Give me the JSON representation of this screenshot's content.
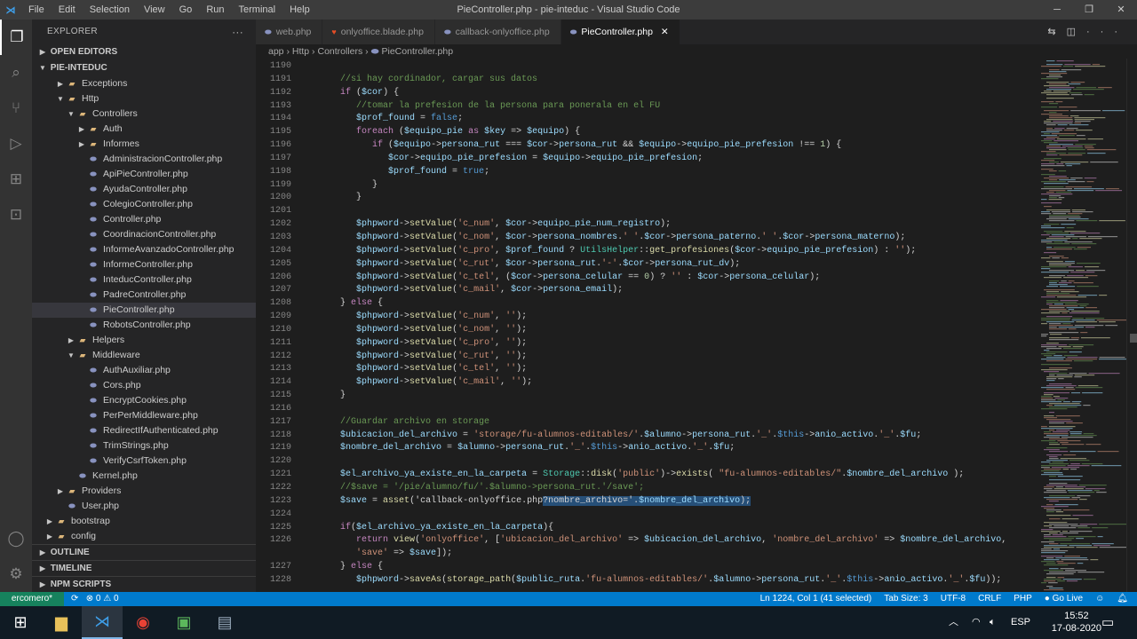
{
  "titlebar": {
    "title": "PieController.php - pie-inteduc - Visual Studio Code",
    "menu": [
      "File",
      "Edit",
      "Selection",
      "View",
      "Go",
      "Run",
      "Terminal",
      "Help"
    ]
  },
  "sidebar": {
    "title": "EXPLORER",
    "open_editors": "OPEN EDITORS",
    "root": "PIE-INTEDUC",
    "tree": [
      {
        "label": "Exceptions",
        "type": "folder",
        "depth": 1,
        "open": false
      },
      {
        "label": "Http",
        "type": "folder",
        "depth": 1,
        "open": true
      },
      {
        "label": "Controllers",
        "type": "folder",
        "depth": 2,
        "open": true
      },
      {
        "label": "Auth",
        "type": "folder",
        "depth": 3,
        "open": false
      },
      {
        "label": "Informes",
        "type": "folder",
        "depth": 3,
        "open": false
      },
      {
        "label": "AdministracionController.php",
        "type": "php",
        "depth": 3
      },
      {
        "label": "ApiPieController.php",
        "type": "php",
        "depth": 3
      },
      {
        "label": "AyudaController.php",
        "type": "php",
        "depth": 3
      },
      {
        "label": "ColegioController.php",
        "type": "php",
        "depth": 3
      },
      {
        "label": "Controller.php",
        "type": "php",
        "depth": 3
      },
      {
        "label": "CoordinacionController.php",
        "type": "php",
        "depth": 3
      },
      {
        "label": "InformeAvanzadoController.php",
        "type": "php",
        "depth": 3
      },
      {
        "label": "InformeController.php",
        "type": "php",
        "depth": 3
      },
      {
        "label": "InteducController.php",
        "type": "php",
        "depth": 3
      },
      {
        "label": "PadreController.php",
        "type": "php",
        "depth": 3
      },
      {
        "label": "PieController.php",
        "type": "php",
        "depth": 3,
        "selected": true
      },
      {
        "label": "RobotsController.php",
        "type": "php",
        "depth": 3
      },
      {
        "label": "Helpers",
        "type": "folder",
        "depth": 2,
        "open": false
      },
      {
        "label": "Middleware",
        "type": "folder",
        "depth": 2,
        "open": true
      },
      {
        "label": "AuthAuxiliar.php",
        "type": "php",
        "depth": 3
      },
      {
        "label": "Cors.php",
        "type": "php",
        "depth": 3
      },
      {
        "label": "EncryptCookies.php",
        "type": "php",
        "depth": 3
      },
      {
        "label": "PerPerMiddleware.php",
        "type": "php",
        "depth": 3
      },
      {
        "label": "RedirectIfAuthenticated.php",
        "type": "php",
        "depth": 3
      },
      {
        "label": "TrimStrings.php",
        "type": "php",
        "depth": 3
      },
      {
        "label": "VerifyCsrfToken.php",
        "type": "php",
        "depth": 3
      },
      {
        "label": "Kernel.php",
        "type": "php",
        "depth": 2
      },
      {
        "label": "Providers",
        "type": "folder",
        "depth": 1,
        "open": false
      },
      {
        "label": "User.php",
        "type": "php",
        "depth": 1
      },
      {
        "label": "bootstrap",
        "type": "folder",
        "depth": 0,
        "open": false
      },
      {
        "label": "config",
        "type": "folder",
        "depth": 0,
        "open": false
      }
    ],
    "bottom": [
      "OUTLINE",
      "TIMELINE",
      "NPM SCRIPTS"
    ]
  },
  "tabs": [
    {
      "label": "web.php",
      "icon": "php"
    },
    {
      "label": "onlyoffice.blade.php",
      "icon": "blade"
    },
    {
      "label": "callback-onlyoffice.php",
      "icon": "php"
    },
    {
      "label": "PieController.php",
      "icon": "php",
      "active": true
    }
  ],
  "breadcrumb": [
    "app",
    "Http",
    "Controllers",
    "PieController.php"
  ],
  "editor": {
    "lines": [
      {
        "n": "1190",
        "t": ""
      },
      {
        "n": "1191",
        "t": "      //si hay cordinador, cargar sus datos"
      },
      {
        "n": "1192",
        "t": "      if ($cor) {"
      },
      {
        "n": "1193",
        "t": "         //tomar la prefesion de la persona para ponerala en el FU"
      },
      {
        "n": "1194",
        "t": "         $prof_found = false;"
      },
      {
        "n": "1195",
        "t": "         foreach ($equipo_pie as $key => $equipo) {"
      },
      {
        "n": "1196",
        "t": "            if ($equipo->persona_rut === $cor->persona_rut && $equipo->equipo_pie_prefesion !== 1) {"
      },
      {
        "n": "1197",
        "t": "               $cor->equipo_pie_prefesion = $equipo->equipo_pie_prefesion;"
      },
      {
        "n": "1198",
        "t": "               $prof_found = true;"
      },
      {
        "n": "1199",
        "t": "            }"
      },
      {
        "n": "1200",
        "t": "         }"
      },
      {
        "n": "1201",
        "t": ""
      },
      {
        "n": "1202",
        "t": "         $phpword->setValue('c_num', $cor->equipo_pie_num_registro);"
      },
      {
        "n": "1203",
        "t": "         $phpword->setValue('c_nom', $cor->persona_nombres.' '.$cor->persona_paterno.' '.$cor->persona_materno);"
      },
      {
        "n": "1204",
        "t": "         $phpword->setValue('c_pro', $prof_found ? UtilsHelper::get_profesiones($cor->equipo_pie_prefesion) : '');"
      },
      {
        "n": "1205",
        "t": "         $phpword->setValue('c_rut', $cor->persona_rut.'-'.$cor->persona_rut_dv);"
      },
      {
        "n": "1206",
        "t": "         $phpword->setValue('c_tel', ($cor->persona_celular == 0) ? '' : $cor->persona_celular);"
      },
      {
        "n": "1207",
        "t": "         $phpword->setValue('c_mail', $cor->persona_email);"
      },
      {
        "n": "1208",
        "t": "      } else {"
      },
      {
        "n": "1209",
        "t": "         $phpword->setValue('c_num', '');"
      },
      {
        "n": "1210",
        "t": "         $phpword->setValue('c_nom', '');"
      },
      {
        "n": "1211",
        "t": "         $phpword->setValue('c_pro', '');"
      },
      {
        "n": "1212",
        "t": "         $phpword->setValue('c_rut', '');"
      },
      {
        "n": "1213",
        "t": "         $phpword->setValue('c_tel', '');"
      },
      {
        "n": "1214",
        "t": "         $phpword->setValue('c_mail', '');"
      },
      {
        "n": "1215",
        "t": "      }"
      },
      {
        "n": "1216",
        "t": ""
      },
      {
        "n": "1217",
        "t": "      //Guardar archivo en storage"
      },
      {
        "n": "1218",
        "t": "      $ubicacion_del_archivo = 'storage/fu-alumnos-editables/'.$alumno->persona_rut.'_'.$this->anio_activo.'_'.$fu;"
      },
      {
        "n": "1219",
        "t": "      $nombre_del_archivo = $alumno->persona_rut.'_'.$this->anio_activo.'_'.$fu;"
      },
      {
        "n": "1220",
        "t": ""
      },
      {
        "n": "1221",
        "t": "      $el_archivo_ya_existe_en_la_carpeta = Storage::disk('public')->exists( \"fu-alumnos-editables/\".$nombre_del_archivo );"
      },
      {
        "n": "1222",
        "t": "      //$save = '/pie/alumno/fu/'.$alumno->persona_rut.'/save';"
      },
      {
        "n": "1223",
        "t": "      $save = asset('callback-onlyoffice.php?nombre_archivo='.$nombre_del_archivo);",
        "sel_from": 41
      },
      {
        "n": "1224",
        "t": ""
      },
      {
        "n": "1225",
        "t": "      if($el_archivo_ya_existe_en_la_carpeta){"
      },
      {
        "n": "1226",
        "t": "         return view('onlyoffice', ['ubicacion_del_archivo' => $ubicacion_del_archivo, 'nombre_del_archivo' => $nombre_del_archivo,"
      },
      {
        "n": "",
        "t": "         'save' => $save]);"
      },
      {
        "n": "1227",
        "t": "      } else {"
      },
      {
        "n": "1228",
        "t": "         $phpword->saveAs(storage_path($public_ruta.'fu-alumnos-editables/'.$alumno->persona_rut.'_'.$this->anio_activo.'_'.$fu));"
      }
    ]
  },
  "statusbar": {
    "remote": "ercomero*",
    "problems": "⊗ 0 ⚠ 0",
    "position": "Ln 1224, Col 1 (41 selected)",
    "tab_size": "Tab Size: 3",
    "encoding": "UTF-8",
    "eol": "CRLF",
    "language": "PHP",
    "golive": "Go Live"
  },
  "taskbar": {
    "lang": "ESP",
    "time": "15:52",
    "date": "17-08-2020"
  },
  "colors": {
    "accent": "#007acc",
    "remote": "#16825d"
  }
}
